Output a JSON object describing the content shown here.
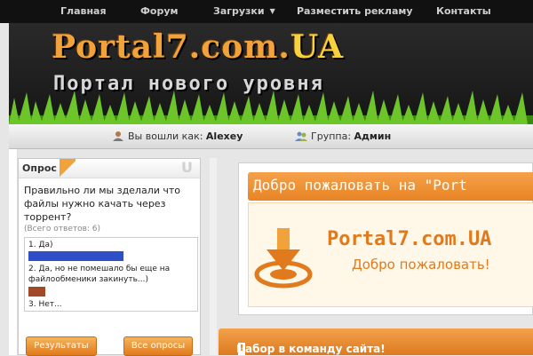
{
  "nav": {
    "items": [
      "Главная",
      "Форум",
      "Загрузки",
      "Разместить рекламу",
      "Контакты"
    ]
  },
  "header": {
    "logo_main": "Portal7.com.",
    "logo_ua": "UA",
    "tagline": "Портал нового уровня"
  },
  "userbar": {
    "logged_label": "Вы вошли как:",
    "username": "Alexey",
    "group_label": "Группа:",
    "group": "Админ"
  },
  "poll": {
    "title": "Опрос",
    "question": "Правильно ли мы зделали что файлы нужно качать через торрент?",
    "total": "(Всего ответов: 6)",
    "answers": [
      {
        "label": "1. Да)",
        "share": 0.5,
        "color": "#2f4fc8"
      },
      {
        "label": "2. Да, но не помешало бы еще на файлообменики закинуть...)",
        "share": 0.09,
        "color": "#a04a2a"
      },
      {
        "label": "3. Нет...",
        "share": 0.0,
        "color": "#888888"
      }
    ],
    "results_button": "Результаты",
    "all_polls_button": "Все опросы"
  },
  "welcome": {
    "heading": "Добро пожаловать на \"Port",
    "brand": "Portal7.com.UA",
    "brand_sub": "Добро пожаловать!"
  },
  "recruit": {
    "title": "Набор в команду сайта!",
    "badge": "!"
  },
  "colors": {
    "accent": "#e88424",
    "nav_bg": "#111111"
  }
}
